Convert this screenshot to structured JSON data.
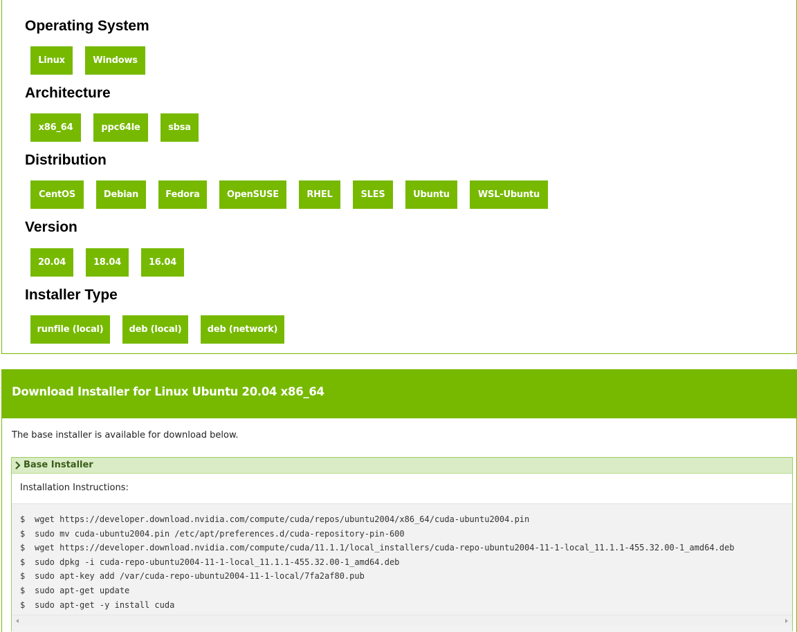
{
  "colors": {
    "accent": "#76b900",
    "installer_header_bg": "#d9ecc5",
    "code_bg": "#f2f2f2"
  },
  "operating_system": {
    "title": "Operating System",
    "options": [
      "Linux",
      "Windows"
    ]
  },
  "architecture": {
    "title": "Architecture",
    "options": [
      "x86_64",
      "ppc64le",
      "sbsa"
    ]
  },
  "distribution": {
    "title": "Distribution",
    "options": [
      "CentOS",
      "Debian",
      "Fedora",
      "OpenSUSE",
      "RHEL",
      "SLES",
      "Ubuntu",
      "WSL-Ubuntu"
    ]
  },
  "version": {
    "title": "Version",
    "options": [
      "20.04",
      "18.04",
      "16.04"
    ]
  },
  "installer_type": {
    "title": "Installer Type",
    "options": [
      "runfile (local)",
      "deb (local)",
      "deb (network)"
    ]
  },
  "download": {
    "title": "Download Installer for Linux Ubuntu 20.04 x86_64",
    "description": "The base installer is available for download below.",
    "installer": {
      "title": "Base Installer",
      "icon": "chevron-right-icon",
      "instructions_label": "Installation Instructions:",
      "prompt": "$",
      "commands": [
        "wget https://developer.download.nvidia.com/compute/cuda/repos/ubuntu2004/x86_64/cuda-ubuntu2004.pin",
        "sudo mv cuda-ubuntu2004.pin /etc/apt/preferences.d/cuda-repository-pin-600",
        "wget https://developer.download.nvidia.com/compute/cuda/11.1.1/local_installers/cuda-repo-ubuntu2004-11-1-local_11.1.1-455.32.00-1_amd64.deb",
        "sudo dpkg -i cuda-repo-ubuntu2004-11-1-local_11.1.1-455.32.00-1_amd64.deb",
        "sudo apt-key add /var/cuda-repo-ubuntu2004-11-1-local/7fa2af80.pub",
        "sudo apt-get update",
        "sudo apt-get -y install cuda"
      ]
    }
  }
}
